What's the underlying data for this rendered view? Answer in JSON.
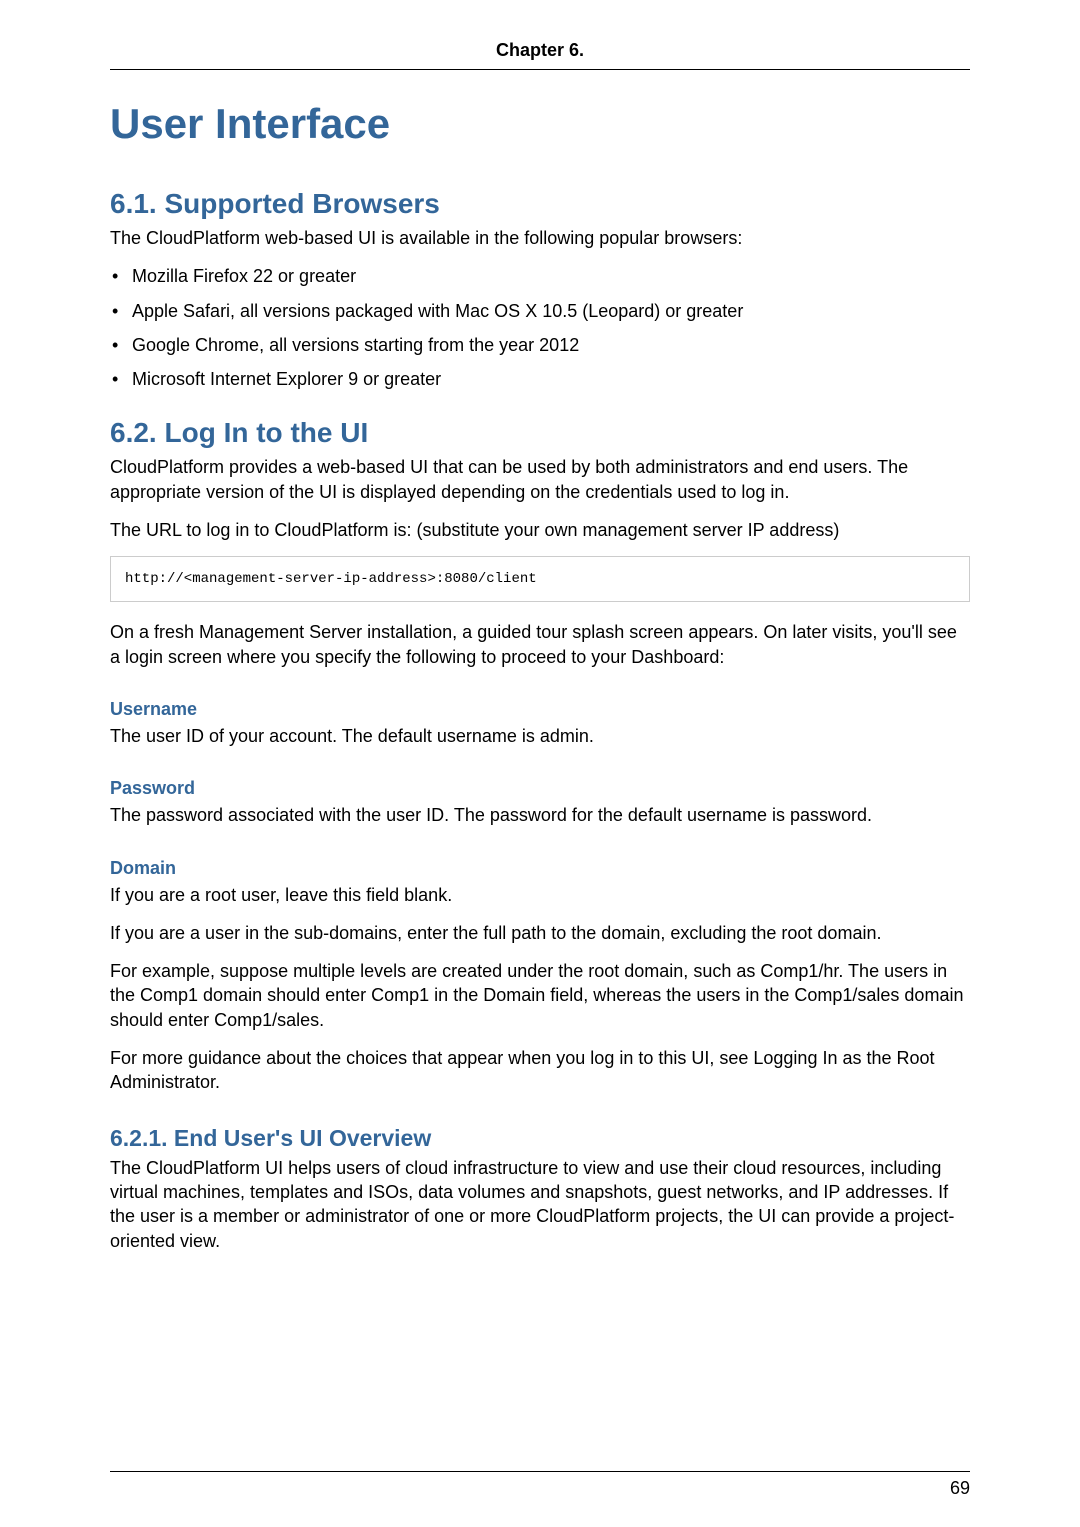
{
  "header": {
    "chapter_label": "Chapter 6."
  },
  "title": "User Interface",
  "sec61": {
    "heading": "6.1. Supported Browsers",
    "intro": "The CloudPlatform web-based UI is available in the following popular browsers:",
    "items": [
      "Mozilla Firefox 22 or greater",
      "Apple Safari, all versions packaged with Mac OS X 10.5 (Leopard) or greater",
      "Google Chrome, all versions starting from the year 2012",
      "Microsoft Internet Explorer 9 or greater"
    ]
  },
  "sec62": {
    "heading": "6.2. Log In to the UI",
    "p1": "CloudPlatform provides a web-based UI that can be used by both administrators and end users. The appropriate version of the UI is displayed depending on the credentials used to log in.",
    "p2": "The URL to log in to CloudPlatform is: (substitute your own management server IP address)",
    "code": "http://<management-server-ip-address>:8080/client",
    "p3": "On a fresh Management Server installation, a guided tour splash screen appears. On later visits, you'll see a login screen where you specify the following to proceed to your Dashboard:",
    "username_h": "Username",
    "username_p": "The user ID of your account. The default username is admin.",
    "password_h": "Password",
    "password_p": "The password associated with the user ID. The password for the default username is password.",
    "domain_h": "Domain",
    "domain_p1": "If you are a root user, leave this field blank.",
    "domain_p2": "If you are a user in the sub-domains, enter the full path to the domain, excluding the root domain.",
    "domain_p3": "For example, suppose multiple levels are created under the root domain, such as Comp1/hr. The users in the Comp1 domain should enter Comp1 in the Domain field, whereas the users in the Comp1/sales domain should enter Comp1/sales.",
    "domain_p4": "For more guidance about the choices that appear when you log in to this UI, see Logging In as the Root Administrator."
  },
  "sec621": {
    "heading": "6.2.1. End User's UI Overview",
    "p1": "The CloudPlatform UI helps users of cloud infrastructure to view and use their cloud resources, including virtual machines, templates and ISOs, data volumes and snapshots, guest networks, and IP addresses. If the user is a member or administrator of one or more CloudPlatform projects, the UI can provide a project-oriented view."
  },
  "footer": {
    "page_number": "69"
  }
}
